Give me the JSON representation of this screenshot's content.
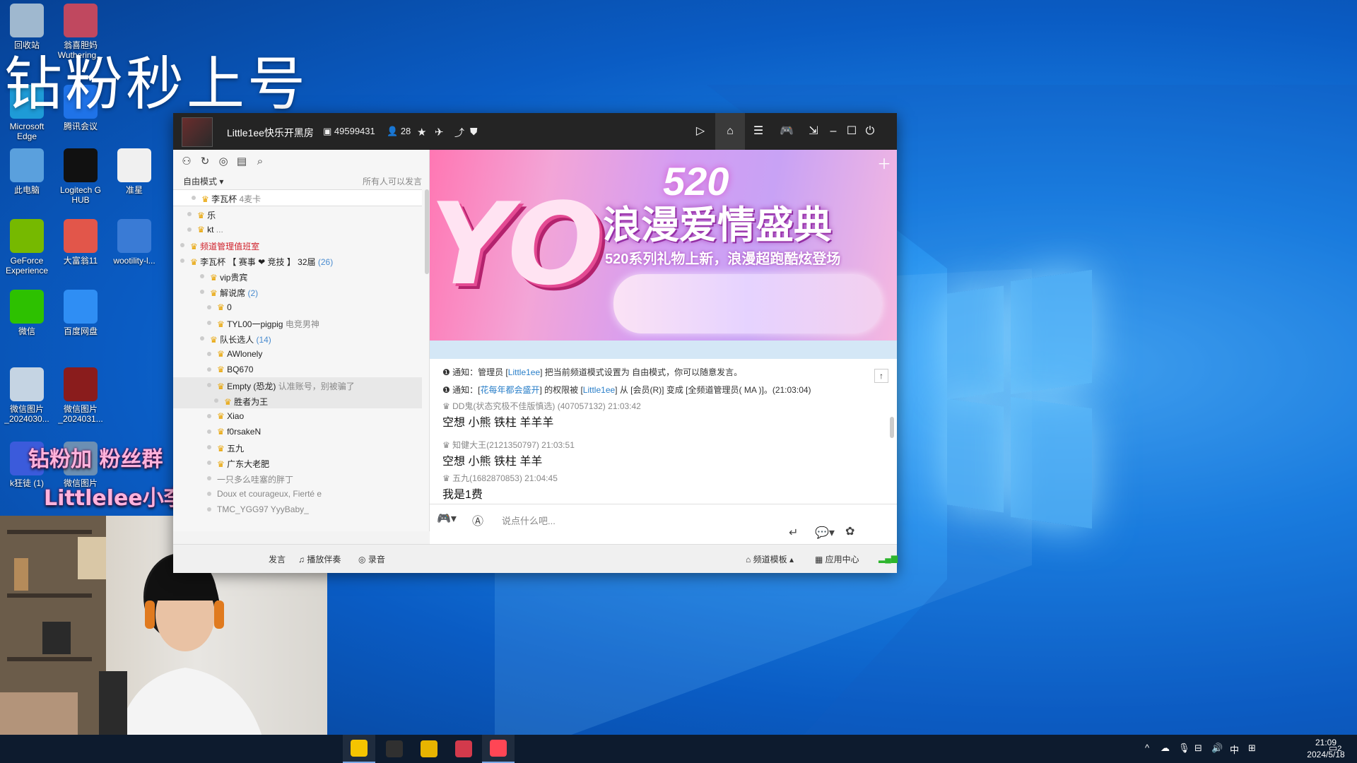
{
  "desktop": {
    "icons": [
      {
        "label": "回收站",
        "color": "#9fb8cf"
      },
      {
        "label": "翁喜胆妈 Wuthering...",
        "color": "#c0485f"
      },
      {
        "label": "Microsoft Edge",
        "color": "#1e9bd7"
      },
      {
        "label": "腾讯会议",
        "color": "#1f73e8"
      },
      {
        "label": "此电脑",
        "color": "#5aa0dd"
      },
      {
        "label": "Logitech G HUB",
        "color": "#111111"
      },
      {
        "label": "准星",
        "color": "#f0f0f0"
      },
      {
        "label": "GeForce Experience",
        "color": "#76b900"
      },
      {
        "label": "大富翁11",
        "color": "#e2564a"
      },
      {
        "label": "wootility-l...",
        "color": "#3a7bd5"
      },
      {
        "label": "微信",
        "color": "#2dc100"
      },
      {
        "label": "百度网盘",
        "color": "#2f8ef4"
      },
      {
        "label": "微信图片 _2024030...",
        "color": "#c5d4e3"
      },
      {
        "label": "微信图片 _2024031...",
        "color": "#8a1c1c"
      },
      {
        "label": "k狂徒 (1)",
        "color": "#3b5bdb"
      },
      {
        "label": "微信图片",
        "color": "#6b8fb3"
      }
    ],
    "overlay_title": "钻粉秒上号",
    "promo_line1": "钻粉加   粉丝群",
    "promo_line2": "Littlelee小李 (无畏契约)"
  },
  "window": {
    "room_title": "Little1ee快乐开黑房",
    "room_id": "49599431",
    "online_count": "28",
    "toolbar_icons": [
      "video-icon",
      "home-icon",
      "list-icon",
      "gamepad-icon",
      "download-icon",
      "minimize-icon",
      "maximize-icon",
      "power-icon"
    ]
  },
  "left": {
    "mode": "自由模式",
    "permission": "所有人可以发言",
    "tree": [
      {
        "label": "李瓦杯",
        "extra": "4麦卡",
        "indent": 40,
        "selected": true
      },
      {
        "label": "乐",
        "extra": "",
        "indent": 34
      },
      {
        "label": "kt",
        "extra": "...",
        "indent": 34
      },
      {
        "label": "频道管理值班室",
        "extra": "",
        "indent": 24,
        "red": true
      },
      {
        "label": "李瓦杯 【 赛事 ❤ 竞技 】 32届",
        "extra": "(26)",
        "indent": 24
      },
      {
        "label": "vip贵宾",
        "extra": "",
        "indent": 52
      },
      {
        "label": "解说席",
        "extra": "(2)",
        "indent": 52
      },
      {
        "label": "0",
        "extra": "",
        "indent": 62
      },
      {
        "label": "TYL00一pigpig",
        "extra": "电竞男神",
        "indent": 62
      },
      {
        "label": "队长选人",
        "extra": "(14)",
        "indent": 52
      },
      {
        "label": "AWlonely",
        "extra": "",
        "indent": 62
      },
      {
        "label": "BQ670",
        "extra": "",
        "indent": 62
      },
      {
        "label": "Empty (恐龙)",
        "extra": "认准账号，别被骗了",
        "indent": 62,
        "hover": true
      },
      {
        "label": "胜者为王",
        "extra": "",
        "indent": 72,
        "hover": true
      },
      {
        "label": "Xiao",
        "extra": "",
        "indent": 62
      },
      {
        "label": "f0rsakeN",
        "extra": "",
        "indent": 62
      },
      {
        "label": "五九",
        "extra": "",
        "indent": 62
      },
      {
        "label": "广东大老肥",
        "extra": "",
        "indent": 62
      },
      {
        "label": "",
        "extra": "一只多么哇塞的胖丁",
        "indent": 62
      },
      {
        "label": "",
        "extra": "Doux et courageux, Fierté e",
        "indent": 62
      },
      {
        "label": "",
        "extra": "TMC_YGG97 YyyBaby_",
        "indent": 62
      }
    ]
  },
  "banner": {
    "yo": "YO",
    "number": "520",
    "title": "浪漫爱情盛典",
    "subtitle": "520系列礼物上新，浪漫超跑酷炫登场"
  },
  "chat": {
    "notice1": {
      "prefix": "通知：管理员 [",
      "admin": "Little1ee",
      "suffix": "] 把当前频道模式设置为 自由模式，你可以随意发言。"
    },
    "notice2": {
      "prefix": "通知：[",
      "user": "花每年都会盛开",
      "mid": "] 的权限被 [",
      "admin": "Little1ee",
      "suffix": "] 从 [会员(R)] 变成 [全频道管理员( MA )]。(21:03:04)"
    },
    "messages": [
      {
        "user": "DD鬼(状态究极不佳版慎选) (407057132)",
        "time": "21:03:42",
        "text": "空想  小熊 铁柱   羊羊羊"
      },
      {
        "user": "知健大王(2121350797)",
        "time": "21:03:51",
        "text": "空想 小熊 铁柱   羊羊"
      },
      {
        "user": "五九(1682870853)",
        "time": "21:04:45",
        "text": "我是1费"
      }
    ],
    "input_placeholder": "说点什么吧..."
  },
  "bottom": {
    "speak": "发言",
    "accompany": "播放伴奏",
    "record": "录音",
    "template": "频道模板",
    "app_center": "应用中心"
  },
  "taskbar": {
    "apps": [
      {
        "name": "yy-app",
        "color": "#f5c400",
        "active": true
      },
      {
        "name": "obs-app",
        "color": "#303030",
        "active": false
      },
      {
        "name": "chrome-app",
        "color": "#e8b400",
        "active": false
      },
      {
        "name": "valorant-app",
        "color": "#d33a4c",
        "active": false
      },
      {
        "name": "valorant-app-2",
        "color": "#ff4655",
        "active": true
      }
    ],
    "ime": "中",
    "time": "21:09",
    "date": "2024/5/18",
    "notifications": "2"
  }
}
